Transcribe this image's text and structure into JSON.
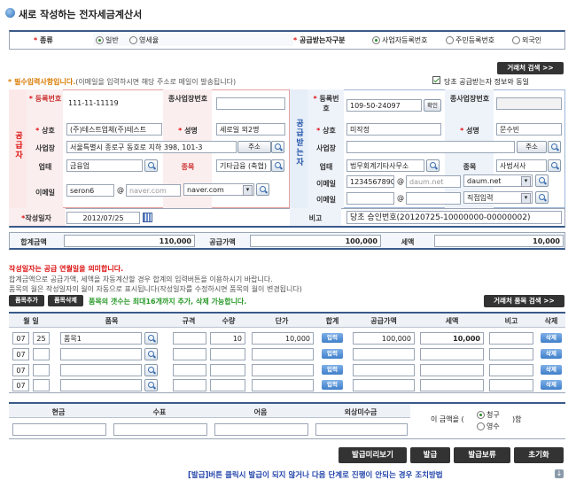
{
  "title": "새로 작성하는 전자세금계산서",
  "kind": {
    "label": "종류",
    "opt1": "일반",
    "opt2": "영세율"
  },
  "recvType": {
    "label": "공급받는자구분",
    "opt1": "사업자등록번호",
    "opt2": "주민등록번호",
    "opt3": "외국인"
  },
  "customerSearch": "거래처 검색 >>",
  "required": {
    "strong": "* 필수입력사항입니다.",
    "note": "(이메일을 입력하시면 해당 주소로 메일이 발송됩니다)"
  },
  "sameInfo": "당초 공급받는자 정보와 동일",
  "supplier": {
    "side": "공급자",
    "regNoLabel": "등록번호",
    "regNo": "111-11-11119",
    "subLabel": "종사업장번호",
    "nameLabel": "상호",
    "name": "(주)테스트업체(주)테스트",
    "ceoLabel": "성명",
    "ceo": "세로일 외2명",
    "addrLabel": "사업장",
    "addr": "서울특별시 종로구 동호로 지하 398, 101-3",
    "addrBtn": "주소",
    "typeLabel": "업태",
    "type": "금융업",
    "itemLabel": "종목",
    "item": "기타금융 (축협)",
    "emailLabel": "이메일",
    "emailId": "seron6",
    "emailDomain": "naver.com",
    "emailSel": "naver.com"
  },
  "receiver": {
    "side": "공급받는자",
    "regNoLabel": "등록번호",
    "regNo": "109-50-24097",
    "confirm": "확인",
    "subLabel": "종사업장번호",
    "nameLabel": "상호",
    "name": "미작정",
    "ceoLabel": "성명",
    "ceo": "문수빈",
    "addrLabel": "사업장",
    "addrBtn": "주소",
    "typeLabel": "업태",
    "type": "법무회계기타사무소",
    "itemLabel": "종목",
    "item": "사법서사",
    "emailLabel": "이메일",
    "emailId": "1234567890",
    "emailDomain": "daum.net",
    "emailSel": "daum.net",
    "email2Label": "이메일",
    "email2Sel": "직접입력"
  },
  "date": {
    "label": "작성일자",
    "value": "2012/07/25"
  },
  "remark": {
    "label": "비고",
    "value": "당초 승인번호(20120725-10000000-00000002)"
  },
  "totals": {
    "sumLabel": "합계금액",
    "sum": "110,000",
    "supplyLabel": "공급가액",
    "supply": "100,000",
    "taxLabel": "세액",
    "tax": "10,000"
  },
  "notice": {
    "red": "작성일자는 공급 연월일을 의미합니다.",
    "l1": "합계금액으로 공급가액, 세액을 자동계산할 경우 합계의 입력버튼을 이용하시기 바랍니다.",
    "l2": "품목의 월은 작성일자의 월이 자동으로 표시됩니다(작성일자를 수정하시면 품목의 월이 변경됩니다)"
  },
  "itemAdd": "품목추가",
  "itemDel": "품목삭제",
  "itemNote": "품목의 갯수는 최대16개까지 추가, 삭제 가능합니다.",
  "itemSearch": "거래처 품목 검색 >>",
  "cols": [
    "월 일",
    "품목",
    "규격",
    "수량",
    "단가",
    "합계",
    "공급가액",
    "세액",
    "비고",
    "삭제"
  ],
  "rows": [
    {
      "m": "07",
      "d": "25",
      "name": "품목1",
      "qty": "10",
      "price": "10,000",
      "supply": "100,000",
      "tax": "10,000"
    },
    {
      "m": "07",
      "d": "",
      "name": "",
      "qty": "",
      "price": "",
      "supply": "",
      "tax": ""
    },
    {
      "m": "07",
      "d": "",
      "name": "",
      "qty": "",
      "price": "",
      "supply": "",
      "tax": ""
    },
    {
      "m": "07",
      "d": "",
      "name": "",
      "qty": "",
      "price": "",
      "supply": "",
      "tax": ""
    }
  ],
  "inputBtn": "입력",
  "delBtn": "삭제",
  "pay": {
    "cash": "현금",
    "check": "수표",
    "note": "어음",
    "credit": "외상미수금",
    "prefix": "이 금액을",
    "claim": "청구",
    "receipt": "영수",
    "suffix": ")함"
  },
  "actions": {
    "preview": "발급미리보기",
    "issue": "발급",
    "hold": "발급보류",
    "reset": "초기화"
  },
  "footer": "[발급]버튼 클릭시 발급이 되지 않거나 다음 단계로 진행이 안되는 경우 조치방법"
}
